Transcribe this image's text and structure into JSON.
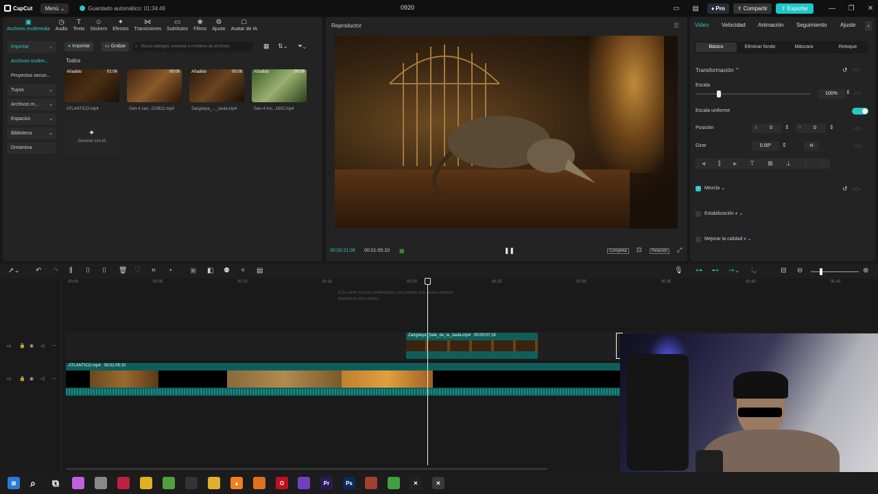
{
  "titlebar": {
    "app_name": "CapCut",
    "menu_label": "Menú",
    "autosave_text": "Guardado automático: 01:34:49",
    "project_title": "0920",
    "pro_label": "Pro",
    "share_label": "Compartir",
    "export_label": "Exportar"
  },
  "toolbar": {
    "tools": [
      "Archivos multimedia",
      "Audio",
      "Texto",
      "Stickers",
      "Efectos",
      "Transiciones",
      "Subtítulos",
      "Filtros",
      "Ajuste",
      "Avatar de IA"
    ]
  },
  "sidebar": {
    "items": [
      "Importar",
      "Archivos multim...",
      "Proyectos secun...",
      "Tuyos",
      "Archivos m...",
      "Espacios",
      "Biblioteca",
      "Dreamina"
    ]
  },
  "media": {
    "import_label": "Importar",
    "record_label": "Grabar",
    "search_placeholder": "Busca diálogos, escenas o nombres de archivos",
    "filter_label": "Todos",
    "items": [
      {
        "name": "ATLANTICO.mp4",
        "badge": "Añadido",
        "duration": "01:06"
      },
      {
        "name": "Gen-4 zari...013611.mp4",
        "badge": "",
        "duration": "00:06"
      },
      {
        "name": "Zarigüeya_..._Jaula.mp4",
        "badge": "Añadido",
        "duration": "00:08"
      },
      {
        "name": "Gen-4 mo...1502.mp4",
        "badge": "Añadido",
        "duration": "00:06"
      }
    ],
    "ai_label": "Generar con IA"
  },
  "player": {
    "title": "Reproductor",
    "current_time": "00:00:21:06",
    "total_time": "00:01:05:10",
    "full_label": "Completa",
    "ratio_label": "Relación"
  },
  "inspector": {
    "tabs": [
      "Video",
      "Velocidad",
      "Animación",
      "Seguimiento",
      "Ajuste"
    ],
    "subtabs": [
      "Básico",
      "Eliminar fondo",
      "Máscara",
      "Retoque"
    ],
    "section_transform": "Transformación",
    "scale_label": "Escala",
    "scale_value": "100%",
    "scale_fraction": 0.2,
    "uniform_label": "Escala uniforme",
    "position_label": "Posición",
    "x_label": "X",
    "x_value": "0",
    "y_label": "Y",
    "y_value": "0",
    "rotate_label": "Girar",
    "rotate_value": "0.00º",
    "blend_label": "Mezcla",
    "stabilize_label": "Estabilización",
    "enhance_label": "Mejorar la calidad"
  },
  "timeline": {
    "ticks": [
      "00:00",
      "00:05",
      "00:10",
      "00:15",
      "00:20",
      "00:25",
      "00:30",
      "00:35",
      "00:40",
      "00:45"
    ],
    "render_notice": "Esta parte no está renderizada y es posible que cause retrasos durante la vista previa.",
    "clip_top_label": "Zarigüeya_Sale_de_la_Jaula.mp4   00:00:07:19",
    "clip_main_label": "ATLANTICO.mp4   00:01:05:10"
  },
  "colors": {
    "accent": "#1ec8c8"
  }
}
